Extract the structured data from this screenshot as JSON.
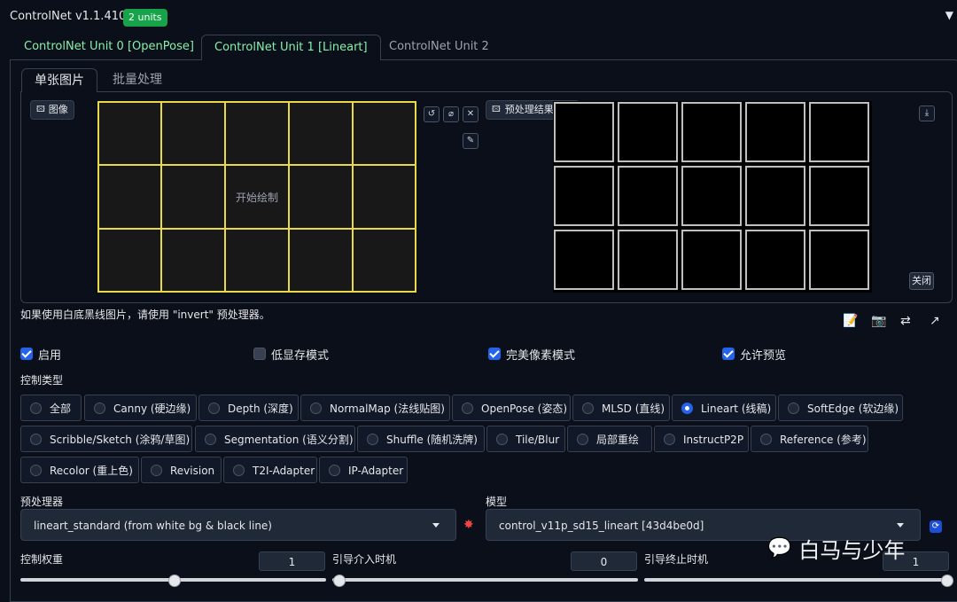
{
  "header": {
    "title": "ControlNet v1.1.410",
    "badge": "2 units",
    "collapse_icon": "▼"
  },
  "unit_tabs": [
    "ControlNet Unit 0 [OpenPose]",
    "ControlNet Unit 1 [Lineart]",
    "ControlNet Unit 2"
  ],
  "sub_tabs": [
    "单张图片",
    "批量处理"
  ],
  "image_panel": {
    "image_label": "图像",
    "canvas_hint": "开始绘制",
    "preview_label": "预处理结果预览",
    "close_label": "关闭"
  },
  "note": "如果使用白底黑线图片，请使用 \"invert\" 预处理器。",
  "checkboxes": [
    {
      "label": "启用",
      "checked": true
    },
    {
      "label": "低显存模式",
      "checked": false
    },
    {
      "label": "完美像素模式",
      "checked": true
    },
    {
      "label": "允许预览",
      "checked": true
    }
  ],
  "control_type": {
    "label": "控制类型",
    "options": [
      "全部",
      "Canny (硬边缘)",
      "Depth (深度)",
      "NormalMap (法线贴图)",
      "OpenPose (姿态)",
      "MLSD (直线)",
      "Lineart (线稿)",
      "SoftEdge (软边缘)",
      "Scribble/Sketch (涂鸦/草图)",
      "Segmentation (语义分割)",
      "Shuffle (随机洗牌)",
      "Tile/Blur",
      "局部重绘",
      "InstructP2P",
      "Reference (参考)",
      "Recolor (重上色)",
      "Revision",
      "T2I-Adapter",
      "IP-Adapter"
    ],
    "selected": "Lineart (线稿)"
  },
  "preprocessor": {
    "label": "预处理器",
    "value": "lineart_standard (from white bg & black line)"
  },
  "model": {
    "label": "模型",
    "value": "control_v11p_sd15_lineart [43d4be0d]"
  },
  "sliders": [
    {
      "label": "控制权重",
      "value": "1",
      "level": 0.5
    },
    {
      "label": "引导介入时机",
      "value": "0",
      "level": 0.0
    },
    {
      "label": "引导终止时机",
      "value": "1",
      "level": 1.0
    }
  ],
  "watermark": "白马与少年",
  "colors": {
    "accent": "#2563eb",
    "badge": "#16a34a",
    "tab_green": "#86efac",
    "grid_yellow": "#e8d94a"
  }
}
